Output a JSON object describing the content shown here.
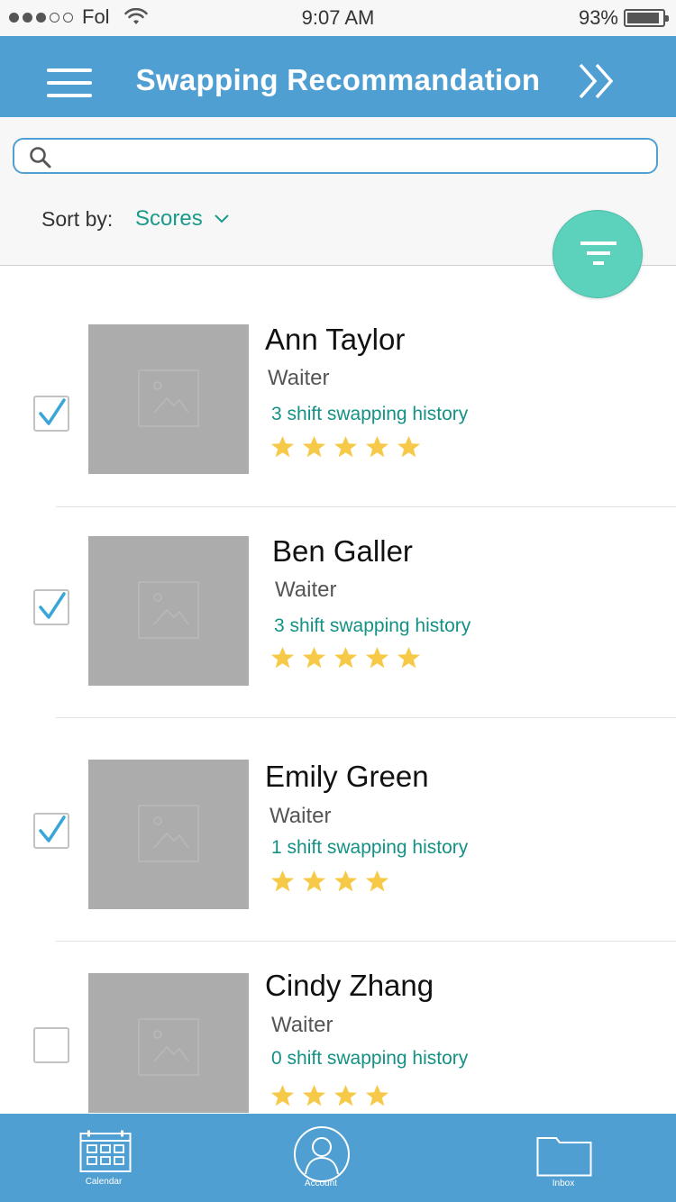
{
  "status_bar": {
    "carrier": "Fol",
    "time": "9:07 AM",
    "battery": "93%",
    "battery_level": 0.93,
    "signal_bars_filled": 3,
    "signal_bars_total": 5
  },
  "header": {
    "title": "Swapping Recommandation",
    "menu_icon": "hamburger-menu-icon",
    "forward_icon": "double-chevron-right-icon"
  },
  "search": {
    "placeholder": "",
    "value": ""
  },
  "sort": {
    "label": "Sort by:",
    "selected": "Scores"
  },
  "colors": {
    "primary": "#4f9fd3",
    "accent_teal": "#1a9a8a",
    "fab": "#5cd1bb",
    "star": "#f7c948",
    "checkbox_check": "#3aa6d8",
    "photo_placeholder": "#acacac"
  },
  "employees": [
    {
      "name": "Ann Taylor",
      "role": "Waiter",
      "history": "3 shift swapping history",
      "rating": 5,
      "checked": true
    },
    {
      "name": "Ben Galler",
      "role": "Waiter",
      "history": "3 shift swapping history",
      "rating": 5,
      "checked": true
    },
    {
      "name": "Emily Green",
      "role": "Waiter",
      "history": "1 shift swapping history",
      "rating": 4,
      "checked": true
    },
    {
      "name": "Cindy Zhang",
      "role": "Waiter",
      "history": "0 shift swapping history",
      "rating": 4,
      "checked": false
    }
  ],
  "tabs": [
    {
      "label": "Calendar",
      "icon": "calendar-icon"
    },
    {
      "label": "Account",
      "icon": "account-icon"
    },
    {
      "label": "Inbox",
      "icon": "folder-icon"
    }
  ]
}
